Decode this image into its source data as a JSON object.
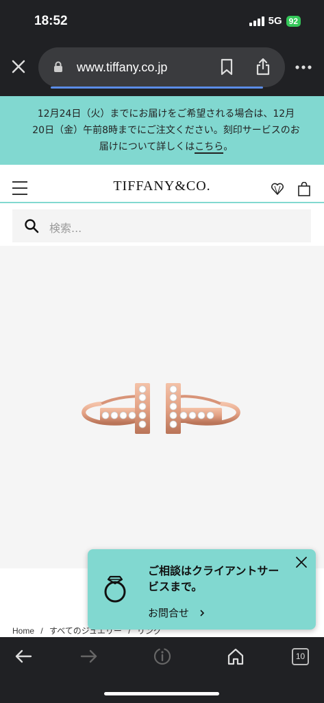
{
  "status": {
    "time": "18:52",
    "network": "5G",
    "battery": "92"
  },
  "browser": {
    "url": "www.tiffany.co.jp",
    "tab_count": "10"
  },
  "notice": {
    "text": "12月24日（火）までにお届けをご希望される場合は、12月20日（金）午前8時までにご注文ください。刻印サービスのお届けについて詳しくは",
    "link": "こちら",
    "suffix": "。"
  },
  "header": {
    "logo": "TIFFANY&CO."
  },
  "search": {
    "placeholder": "検索..."
  },
  "breadcrumb": {
    "items": [
      "Home",
      "/",
      "すべてのジュエリー",
      "/",
      "リング"
    ]
  },
  "chat": {
    "title": "ご相談はクライアントサービスまで。",
    "link": "お問合せ"
  },
  "colors": {
    "brand_blue": "#81d8d0",
    "chrome": "#202124",
    "battery_green": "#34c759",
    "rose_gold": "#e3a184"
  },
  "icons": [
    "close-icon",
    "lock-icon",
    "bookmark-icon",
    "share-icon",
    "more-icon",
    "menu-icon",
    "heart-icon",
    "bag-icon",
    "search-icon",
    "ring-icon",
    "chevron-right-icon",
    "back-icon",
    "forward-icon",
    "info-icon",
    "home-icon"
  ]
}
